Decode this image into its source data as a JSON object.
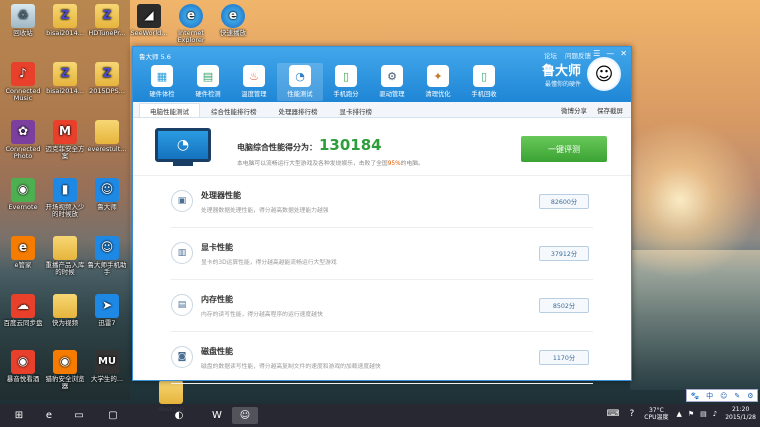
{
  "desktop": {
    "icons": [
      {
        "label": "回收站",
        "glyph": "♻",
        "cls": "recycle"
      },
      {
        "label": "bisai2014...",
        "glyph": "Z",
        "cls": "folderz"
      },
      {
        "label": "HDTunePr...",
        "glyph": "Z",
        "cls": "folderz"
      },
      {
        "label": "SeeWorld...",
        "glyph": "◢",
        "cls": "dark"
      },
      {
        "label": "Internet Explorer",
        "glyph": "e",
        "cls": "ie"
      },
      {
        "label": "快速播放",
        "glyph": "e",
        "cls": "ie"
      },
      {
        "label": "Connected Music",
        "glyph": "♪",
        "cls": "red"
      },
      {
        "label": "bisai2014...",
        "glyph": "Z",
        "cls": "folderz"
      },
      {
        "label": "2015DPS...",
        "glyph": "Z",
        "cls": "folderz"
      },
      {
        "label": "Connected Photo",
        "glyph": "✿",
        "cls": "purple"
      },
      {
        "label": "迈克菲安全方案",
        "glyph": "M",
        "cls": "red"
      },
      {
        "label": "everestult...",
        "glyph": "",
        "cls": "folder"
      },
      {
        "label": "Evernote",
        "glyph": "◉",
        "cls": "green"
      },
      {
        "label": "开场视频入少的时候放",
        "glyph": "▮",
        "cls": "blue"
      },
      {
        "label": "鲁大师",
        "glyph": "☺",
        "cls": "blue"
      },
      {
        "label": "e管家",
        "glyph": "e",
        "cls": "orange"
      },
      {
        "label": "重播产品入库的时候",
        "glyph": "",
        "cls": "folder"
      },
      {
        "label": "鲁大师手机助手",
        "glyph": "☺",
        "cls": "blue"
      },
      {
        "label": "百度云同步盘",
        "glyph": "☁",
        "cls": "red"
      },
      {
        "label": "快为视频",
        "glyph": "",
        "cls": "folder"
      },
      {
        "label": "迅雷7",
        "glyph": "➤",
        "cls": "blue"
      },
      {
        "label": "暴音悦看酒",
        "glyph": "◉",
        "cls": "red"
      },
      {
        "label": "猎豹安全浏览器",
        "glyph": "◉",
        "cls": "orange"
      },
      {
        "label": "大学生的...",
        "glyph": "MU",
        "cls": "mulogo"
      },
      {
        "label": "desktop",
        "glyph": "",
        "cls": "folder"
      }
    ]
  },
  "window": {
    "title": "鲁大师 5.6",
    "links": [
      "论坛",
      "问题反馈"
    ],
    "controls": [
      "☰",
      "—",
      "✕"
    ],
    "tools": [
      {
        "label": "硬件体检",
        "glyph": "▦",
        "color": "#2a9fd8"
      },
      {
        "label": "硬件检测",
        "glyph": "▤",
        "color": "#37a36b"
      },
      {
        "label": "温度管理",
        "glyph": "♨",
        "color": "#e0523a"
      },
      {
        "label": "性能测试",
        "glyph": "◔",
        "color": "#2d7fc9"
      },
      {
        "label": "手机跑分",
        "glyph": "▯",
        "color": "#3aa84a"
      },
      {
        "label": "驱动管理",
        "glyph": "⚙",
        "color": "#44596e"
      },
      {
        "label": "清理优化",
        "glyph": "✦",
        "color": "#c07a2a"
      },
      {
        "label": "手机回收",
        "glyph": "▯",
        "color": "#39a96b"
      }
    ],
    "brand": {
      "name": "鲁大师",
      "slogan": "最懂你的硬件"
    },
    "subtabs": [
      "电脑性能测试",
      "综合性能排行榜",
      "处理器排行榜",
      "显卡排行榜"
    ],
    "subtab_right": [
      "微博分享",
      "保存截屏"
    ],
    "summary": {
      "title": "电脑综合性能得分为：",
      "score": "130184",
      "desc_pre": "本电脑可以流畅运行大型游戏及各种发烧娱乐，击败了全国",
      "desc_pct": "95%",
      "desc_post": "的电脑。",
      "button": "一键评测"
    },
    "items": [
      {
        "name": "处理器性能",
        "desc": "处理器数据处理性能，得分越高数据处理能力越强",
        "score": "82600分",
        "glyph": "▣"
      },
      {
        "name": "显卡性能",
        "desc": "显卡的3D运算性能，得分越高越能流畅运行大型游戏",
        "score": "37912分",
        "glyph": "▥"
      },
      {
        "name": "内存性能",
        "desc": "内存的读写性能，得分越高程序的运行速度越快",
        "score": "8502分",
        "glyph": "▤"
      },
      {
        "name": "磁盘性能",
        "desc": "磁盘的数据读写性能，得分越高复制文件的速度和游戏的加载速度越快",
        "score": "1170分",
        "glyph": "◙"
      }
    ]
  },
  "taskbar": {
    "temp": "37°C",
    "temp_label": "CPU温度",
    "time": "21:20",
    "date": "2015/1/28"
  },
  "ime": [
    "中",
    "☺",
    "✎",
    "⚙"
  ]
}
